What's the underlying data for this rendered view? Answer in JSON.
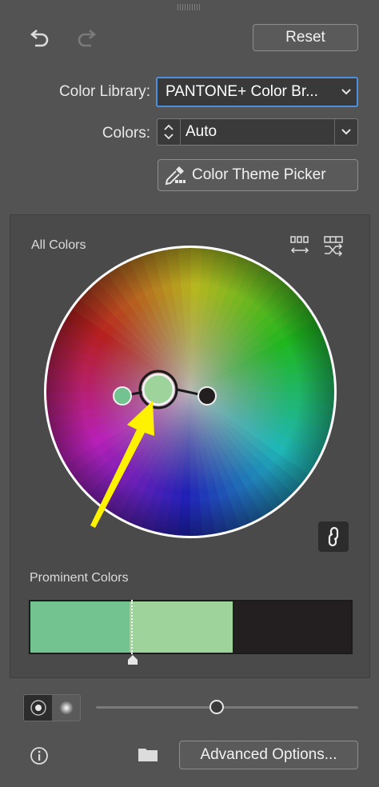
{
  "toolbar": {
    "reset_label": "Reset"
  },
  "color_library": {
    "label": "Color Library:",
    "value": "PANTONE+ Color Br..."
  },
  "colors": {
    "label": "Colors:",
    "value": "Auto"
  },
  "theme_picker": {
    "label": "Color Theme Picker"
  },
  "wheel": {
    "title": "All Colors"
  },
  "prominent": {
    "title": "Prominent Colors",
    "segments": [
      {
        "color": "#72c38f",
        "fraction": 0.31
      },
      {
        "color": "#9ed49b",
        "fraction": 0.32
      },
      {
        "color": "#231f20",
        "fraction": 0.37
      }
    ]
  },
  "footer": {
    "advanced_label": "Advanced Options..."
  },
  "accent": {
    "annotation_arrow": "#fff200"
  }
}
